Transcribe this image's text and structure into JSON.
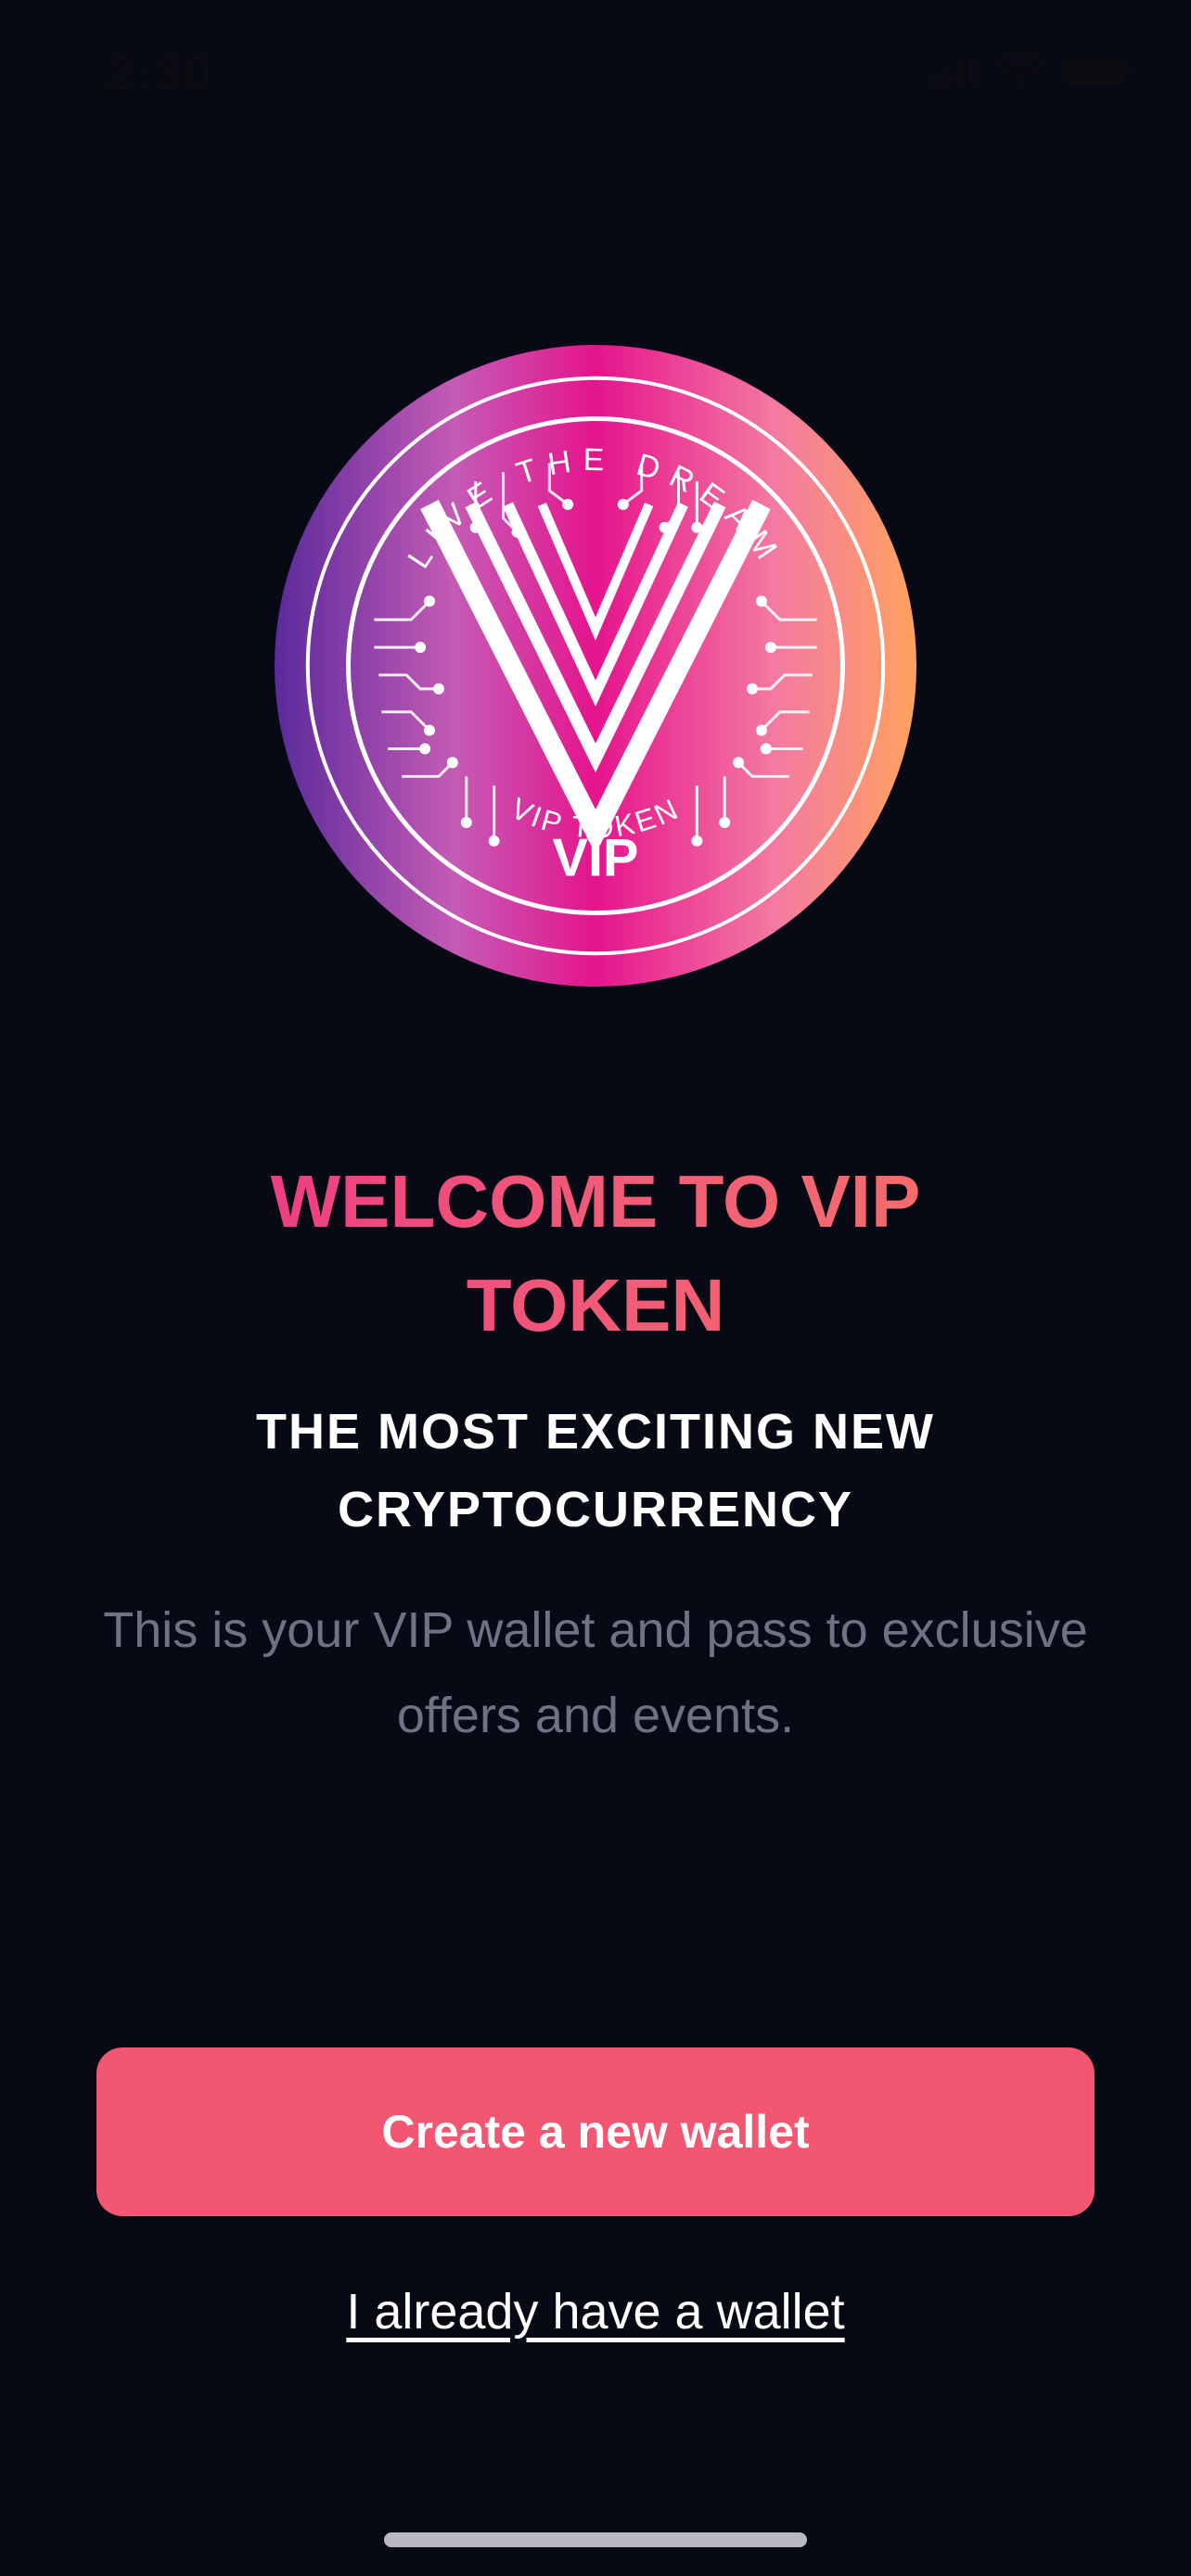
{
  "status_bar": {
    "time": "2:30",
    "icons": [
      "signal-icon",
      "wifi-icon",
      "battery-icon"
    ]
  },
  "logo": {
    "top_text": "LIVE THE DREAM",
    "center_text": "VIP",
    "bottom_text": "VIP TOKEN",
    "colors": {
      "purple": "#5a2a9c",
      "pink": "#e5148d",
      "orange": "#ffa25e"
    }
  },
  "welcome": {
    "title_line1": "WELCOME TO VIP",
    "title_line2": "TOKEN",
    "subtitle_line1": "THE MOST EXCITING NEW",
    "subtitle_line2": "CRYPTOCURRENCY",
    "description_line1": "This is your VIP wallet and pass to exclusive",
    "description_line2": "offers and events."
  },
  "actions": {
    "create_wallet_label": "Create a new wallet",
    "existing_wallet_label": "I already have a wallet"
  },
  "colors": {
    "background": "#070914",
    "accent": "#f25670",
    "muted_text": "#6f7285"
  }
}
